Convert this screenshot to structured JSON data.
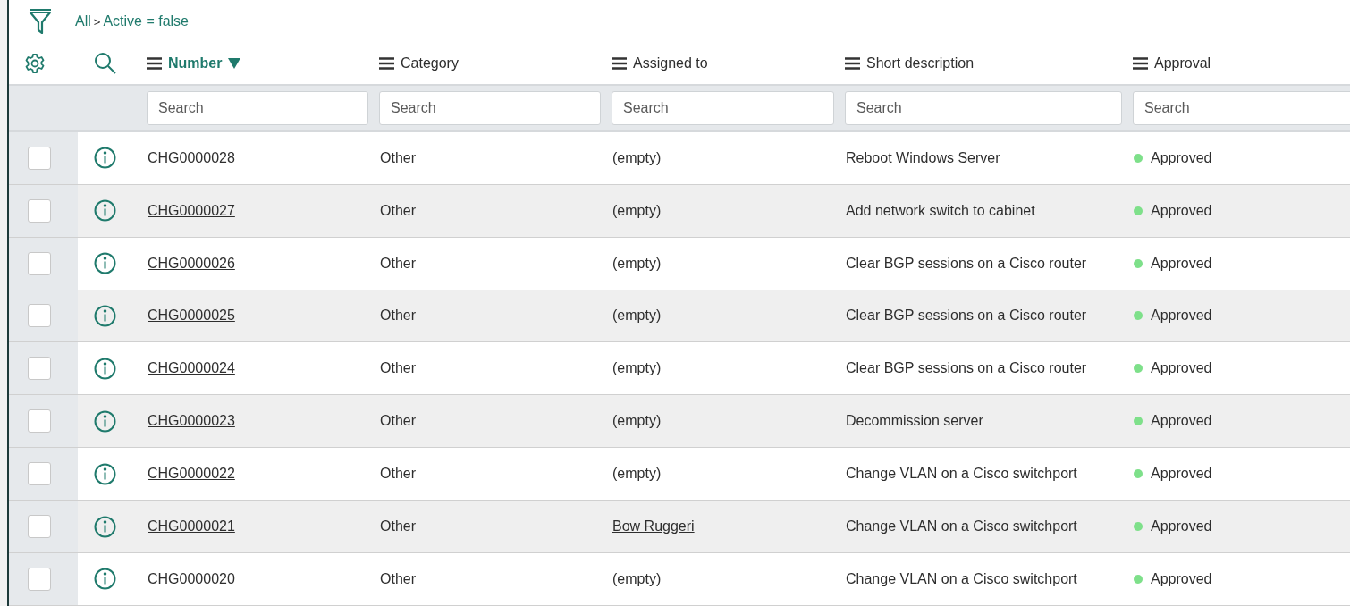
{
  "breadcrumb": {
    "root": "All",
    "separator": ">",
    "condition": "Active = false"
  },
  "columns": [
    {
      "label": "Number",
      "sorted": true,
      "placeholder": "Search"
    },
    {
      "label": "Category",
      "sorted": false,
      "placeholder": "Search"
    },
    {
      "label": "Assigned to",
      "sorted": false,
      "placeholder": "Search"
    },
    {
      "label": "Short description",
      "sorted": false,
      "placeholder": "Search"
    },
    {
      "label": "Approval",
      "sorted": false,
      "placeholder": "Search"
    }
  ],
  "rows": [
    {
      "checked": false,
      "number": "CHG0000028",
      "category": "Other",
      "assigned_to": {
        "kind": "empty",
        "text": "(empty)"
      },
      "short_description": "Reboot Windows Server",
      "approval": {
        "label": "Approved",
        "color": "#7ee08a"
      }
    },
    {
      "checked": false,
      "number": "CHG0000027",
      "category": "Other",
      "assigned_to": {
        "kind": "empty",
        "text": "(empty)"
      },
      "short_description": "Add network switch to cabinet",
      "approval": {
        "label": "Approved",
        "color": "#7ee08a"
      }
    },
    {
      "checked": false,
      "number": "CHG0000026",
      "category": "Other",
      "assigned_to": {
        "kind": "empty",
        "text": "(empty)"
      },
      "short_description": "Clear BGP sessions on a Cisco router",
      "approval": {
        "label": "Approved",
        "color": "#7ee08a"
      }
    },
    {
      "checked": false,
      "number": "CHG0000025",
      "category": "Other",
      "assigned_to": {
        "kind": "empty",
        "text": "(empty)"
      },
      "short_description": "Clear BGP sessions on a Cisco router",
      "approval": {
        "label": "Approved",
        "color": "#7ee08a"
      }
    },
    {
      "checked": false,
      "number": "CHG0000024",
      "category": "Other",
      "assigned_to": {
        "kind": "empty",
        "text": "(empty)"
      },
      "short_description": "Clear BGP sessions on a Cisco router",
      "approval": {
        "label": "Approved",
        "color": "#7ee08a"
      }
    },
    {
      "checked": false,
      "number": "CHG0000023",
      "category": "Other",
      "assigned_to": {
        "kind": "empty",
        "text": "(empty)"
      },
      "short_description": "Decommission server",
      "approval": {
        "label": "Approved",
        "color": "#7ee08a"
      }
    },
    {
      "checked": false,
      "number": "CHG0000022",
      "category": "Other",
      "assigned_to": {
        "kind": "empty",
        "text": "(empty)"
      },
      "short_description": "Change VLAN on a Cisco switchport",
      "approval": {
        "label": "Approved",
        "color": "#7ee08a"
      }
    },
    {
      "checked": false,
      "number": "CHG0000021",
      "category": "Other",
      "assigned_to": {
        "kind": "user",
        "text": "Bow Ruggeri"
      },
      "short_description": "Change VLAN on a Cisco switchport",
      "approval": {
        "label": "Approved",
        "color": "#7ee08a"
      }
    },
    {
      "checked": false,
      "number": "CHG0000020",
      "category": "Other",
      "assigned_to": {
        "kind": "empty",
        "text": "(empty)"
      },
      "short_description": "Change VLAN on a Cisco switchport",
      "approval": {
        "label": "Approved",
        "color": "#7ee08a"
      }
    }
  ]
}
